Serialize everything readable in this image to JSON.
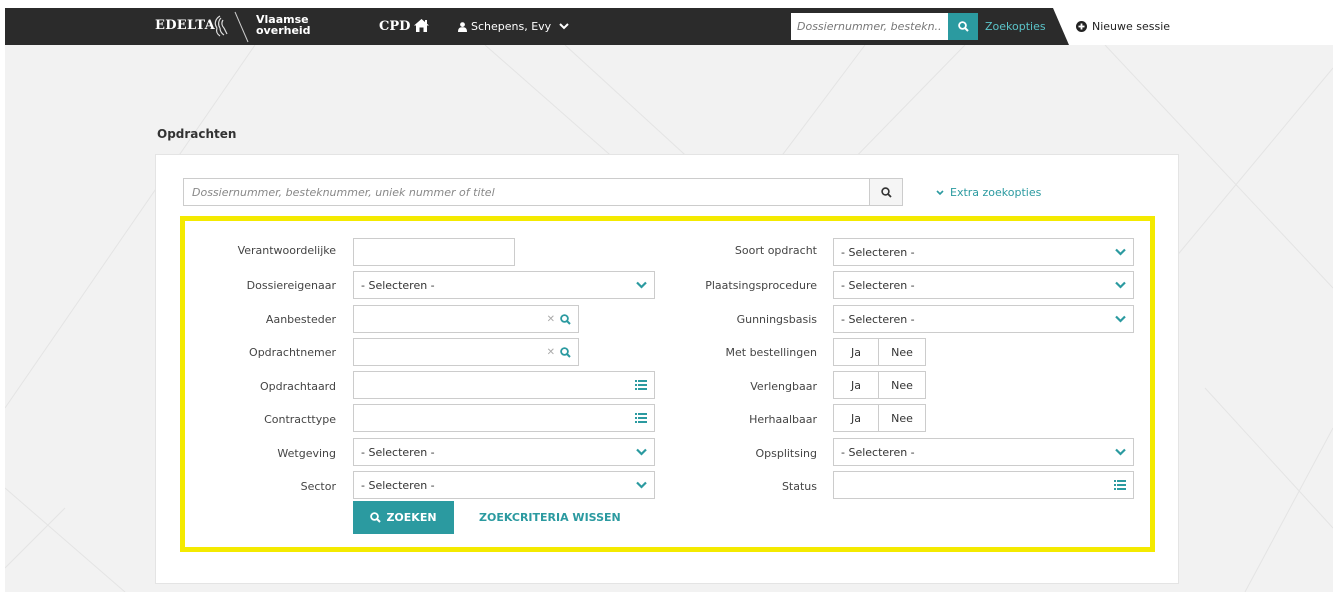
{
  "header": {
    "brand": "EDELTA",
    "gov_line1": "Vlaamse",
    "gov_line2": "overheid",
    "app": "CPD",
    "user": "Schepens, Evy",
    "search_placeholder": "Dossiernummer, bestekn...",
    "search_options_link": "Zoekopties",
    "new_session": "Nieuwe sessie"
  },
  "page": {
    "title": "Opdrachten",
    "search_placeholder": "Dossiernummer, besteknummer, uniek nummer of titel",
    "extra_options": "Extra zoekopties"
  },
  "form": {
    "left": [
      {
        "label": "Verantwoordelijke",
        "value": ""
      },
      {
        "label": "Dossiereigenaar",
        "value": "- Selecteren -"
      },
      {
        "label": "Aanbesteder",
        "value": ""
      },
      {
        "label": "Opdrachtnemer",
        "value": ""
      },
      {
        "label": "Opdrachtaard",
        "value": ""
      },
      {
        "label": "Contracttype",
        "value": ""
      },
      {
        "label": "Wetgeving",
        "value": "- Selecteren -"
      },
      {
        "label": "Sector",
        "value": "- Selecteren -"
      }
    ],
    "right": [
      {
        "label": "Soort opdracht",
        "value": "- Selecteren -"
      },
      {
        "label": "Plaatsingsprocedure",
        "value": "- Selecteren -"
      },
      {
        "label": "Gunningsbasis",
        "value": "- Selecteren -"
      },
      {
        "label": "Met bestellingen",
        "yes": "Ja",
        "no": "Nee"
      },
      {
        "label": "Verlengbaar",
        "yes": "Ja",
        "no": "Nee"
      },
      {
        "label": "Herhaalbaar",
        "yes": "Ja",
        "no": "Nee"
      },
      {
        "label": "Opsplitsing",
        "value": "- Selecteren -"
      },
      {
        "label": "Status",
        "value": ""
      }
    ],
    "search_button": "ZOEKEN",
    "clear_button": "ZOEKCRITERIA WISSEN"
  },
  "colors": {
    "accent": "#2b9aa0",
    "topbar": "#2b2b2b",
    "highlight": "#f4ea00"
  }
}
